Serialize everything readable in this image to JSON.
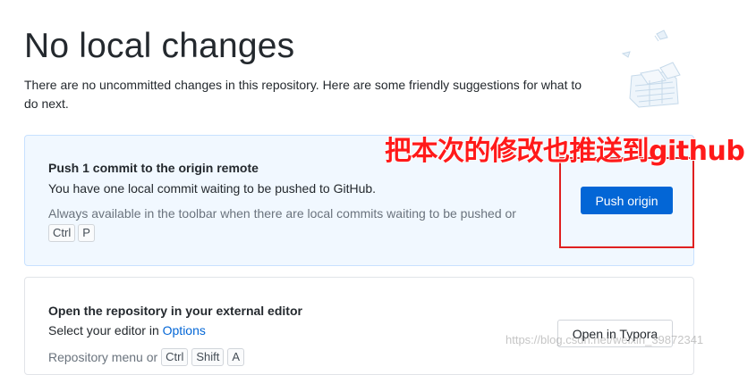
{
  "header": {
    "title": "No local changes",
    "subtitle": "There are no uncommitted changes in this repository. Here are some friendly suggestions for what to do next."
  },
  "push_card": {
    "title": "Push 1 commit to the origin remote",
    "description": "You have one local commit waiting to be pushed to GitHub.",
    "hint": "Always available in the toolbar when there are local commits waiting to be pushed or",
    "shortcut": [
      "Ctrl",
      "P"
    ],
    "button_label": "Push origin"
  },
  "editor_card": {
    "title": "Open the repository in your external editor",
    "description_prefix": "Select your editor in ",
    "options_link": "Options",
    "hint": "Repository menu or",
    "shortcut": [
      "Ctrl",
      "Shift",
      "A"
    ],
    "button_label": "Open in Typora"
  },
  "annotation": {
    "text": "把本次的修改也推送到github",
    "color": "#ff1a1a"
  },
  "watermark": "https://blog.csdn.net/weixin_39872341",
  "colors": {
    "primary": "#0366d6",
    "push_card_bg": "#f1f8ff",
    "annotation": "#e02020"
  }
}
